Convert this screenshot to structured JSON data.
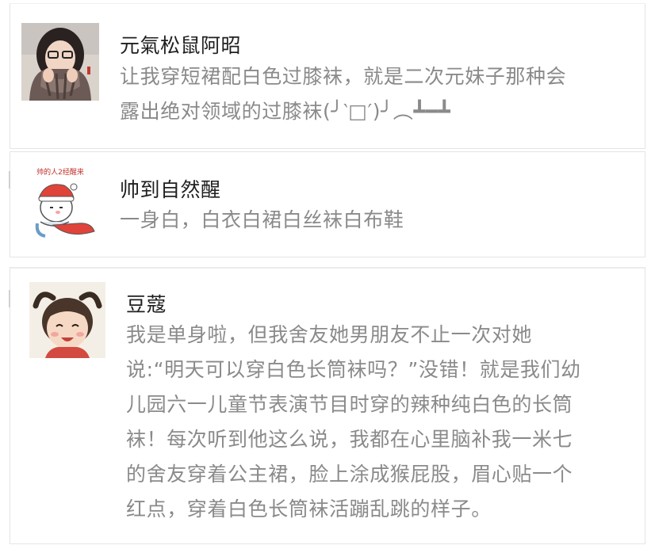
{
  "comments": [
    {
      "author": "元氣松鼠阿昭",
      "avatar_icon": "user-avatar-photo-scarf-icon",
      "lines": [
        "让我穿短裙配白色过膝袜，就是二次元妹子那种会",
        "露出绝对领域的过膝袜(╯‵□′)╯︵┻━┻"
      ]
    },
    {
      "author": "帅到自然醒",
      "avatar_icon": "user-avatar-cartoon-santa-icon",
      "avatar_caption": "帅的人2经醒来",
      "lines": [
        "一身白，白衣白裙白丝袜白布鞋"
      ]
    },
    {
      "author": "豆蔻",
      "avatar_icon": "user-avatar-photo-child-icon",
      "lines": [
        "我是单身啦，但我舍友她男朋友不止一次对她",
        "说:“明天可以穿白色长筒袜吗？”没错！就是我们幼",
        "儿园六一儿童节表演节目时穿的辣种纯白色的长筒",
        "袜！每次听到他这么说，我都在心里脑补我一米七",
        "的舍友穿着公主裙，脸上涂成猴屁股，眉心贴一个",
        "红点，穿着白色长筒袜活蹦乱跳的样子。"
      ]
    }
  ]
}
